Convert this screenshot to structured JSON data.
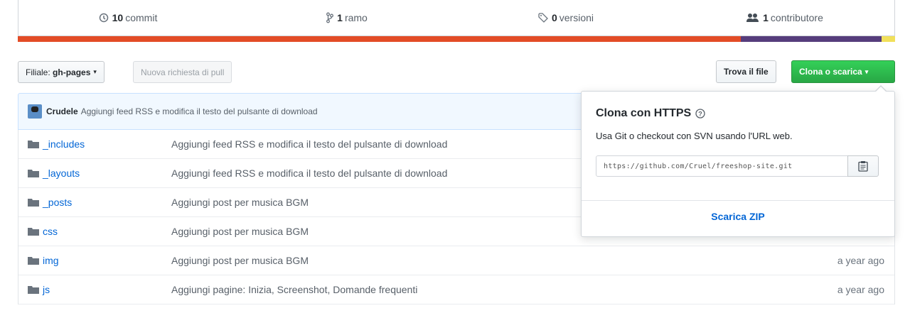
{
  "summary": {
    "commits": {
      "count": "10",
      "label": "commit"
    },
    "branches": {
      "count": "1",
      "label": "ramo"
    },
    "releases": {
      "count": "0",
      "label": "versioni"
    },
    "contributors": {
      "count": "1",
      "label": "contributore"
    }
  },
  "language_bar": [
    {
      "color": "#e34c26",
      "fraction": 0.824
    },
    {
      "color": "#563d7c",
      "fraction": 0.161
    },
    {
      "color": "#f1e05a",
      "fraction": 0.015
    }
  ],
  "toolbar": {
    "branch_prefix": "Filiale:",
    "branch_name": "gh-pages",
    "new_pr_label": "Nuova richiesta di pull",
    "find_file_label": "Trova il file",
    "clone_label": "Clona o scarica"
  },
  "latest_commit": {
    "author": "Crudele",
    "message": "Aggiungi feed RSS e modifica il testo del pulsante di download"
  },
  "files": [
    {
      "name": "_includes",
      "message": "Aggiungi feed RSS e modifica il testo del pulsante di download",
      "age": ""
    },
    {
      "name": "_layouts",
      "message": "Aggiungi feed RSS e modifica il testo del pulsante di download",
      "age": ""
    },
    {
      "name": "_posts",
      "message": "Aggiungi post per musica BGM",
      "age": ""
    },
    {
      "name": "css",
      "message": "Aggiungi post per musica BGM",
      "age": ""
    },
    {
      "name": "img",
      "message": "Aggiungi post per musica BGM",
      "age": "a year ago"
    },
    {
      "name": "js",
      "message": "Aggiungi pagine: Inizia, Screenshot, Domande frequenti",
      "age": "a year ago"
    }
  ],
  "clone_popover": {
    "title": "Clona con HTTPS",
    "description": "Usa Git o checkout con SVN usando l'URL web.",
    "url": "https://github.com/Cruel/freeshop-site.git",
    "download_zip": "Scarica ZIP"
  }
}
